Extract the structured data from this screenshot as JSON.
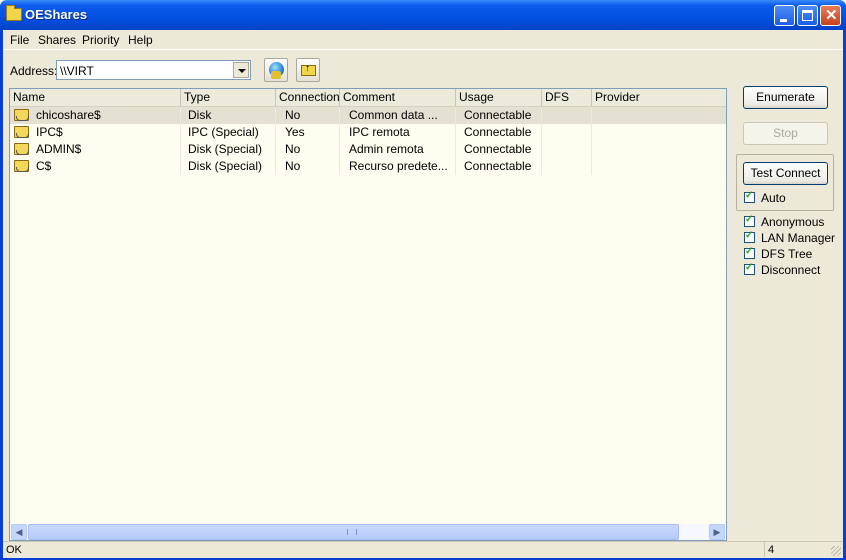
{
  "window": {
    "title": "OEShares"
  },
  "menu": [
    "File",
    "Shares",
    "Priority",
    "Help"
  ],
  "address": {
    "label": "Address:",
    "value": "\\\\VIRT"
  },
  "columns": [
    "Name",
    "Type",
    "Connection",
    "Comment",
    "Usage",
    "DFS",
    "Provider"
  ],
  "rows": [
    {
      "name": "chicoshare$",
      "type": "Disk",
      "connection": "No",
      "comment": "Common data ...",
      "usage": "Connectable",
      "dfs": "",
      "provider": ""
    },
    {
      "name": "IPC$",
      "type": "IPC (Special)",
      "connection": "Yes",
      "comment": "IPC remota",
      "usage": "Connectable",
      "dfs": "",
      "provider": ""
    },
    {
      "name": "ADMIN$",
      "type": "Disk (Special)",
      "connection": "No",
      "comment": "Admin remota",
      "usage": "Connectable",
      "dfs": "",
      "provider": ""
    },
    {
      "name": "C$",
      "type": "Disk (Special)",
      "connection": "No",
      "comment": "Recurso predete...",
      "usage": "Connectable",
      "dfs": "",
      "provider": ""
    }
  ],
  "buttons": {
    "enumerate": "Enumerate",
    "stop": "Stop",
    "test_connect": "Test Connect"
  },
  "checkboxes": {
    "auto": "Auto",
    "anonymous": "Anonymous",
    "lan_manager": "LAN Manager",
    "dfs_tree": "DFS Tree",
    "disconnect": "Disconnect"
  },
  "status": {
    "left": "OK",
    "right": "4"
  }
}
